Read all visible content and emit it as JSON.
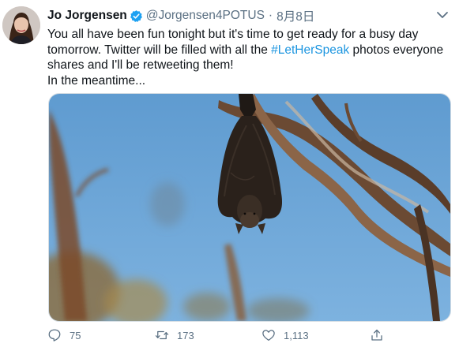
{
  "author": {
    "display_name": "Jo Jorgensen",
    "handle": "@Jorgensen4POTUS",
    "separator": "·",
    "timestamp": "8月8日"
  },
  "tweet": {
    "text_part1": "You all have been fun tonight but it's time to get ready for a busy day tomorrow. Twitter will be filled with all the ",
    "hashtag": "#LetHerSpeak",
    "text_part2": " photos everyone shares and I'll be retweeting them!",
    "text_line2": "In the meantime..."
  },
  "actions": {
    "reply_count": "75",
    "retweet_count": "173",
    "like_count": "1,113"
  },
  "colors": {
    "link": "#1b95e0",
    "verified": "#1da1f2",
    "muted": "#5b7083"
  },
  "icons": [
    "verified-badge-icon",
    "caret-down-icon",
    "reply-icon",
    "retweet-icon",
    "like-icon",
    "share-icon"
  ]
}
